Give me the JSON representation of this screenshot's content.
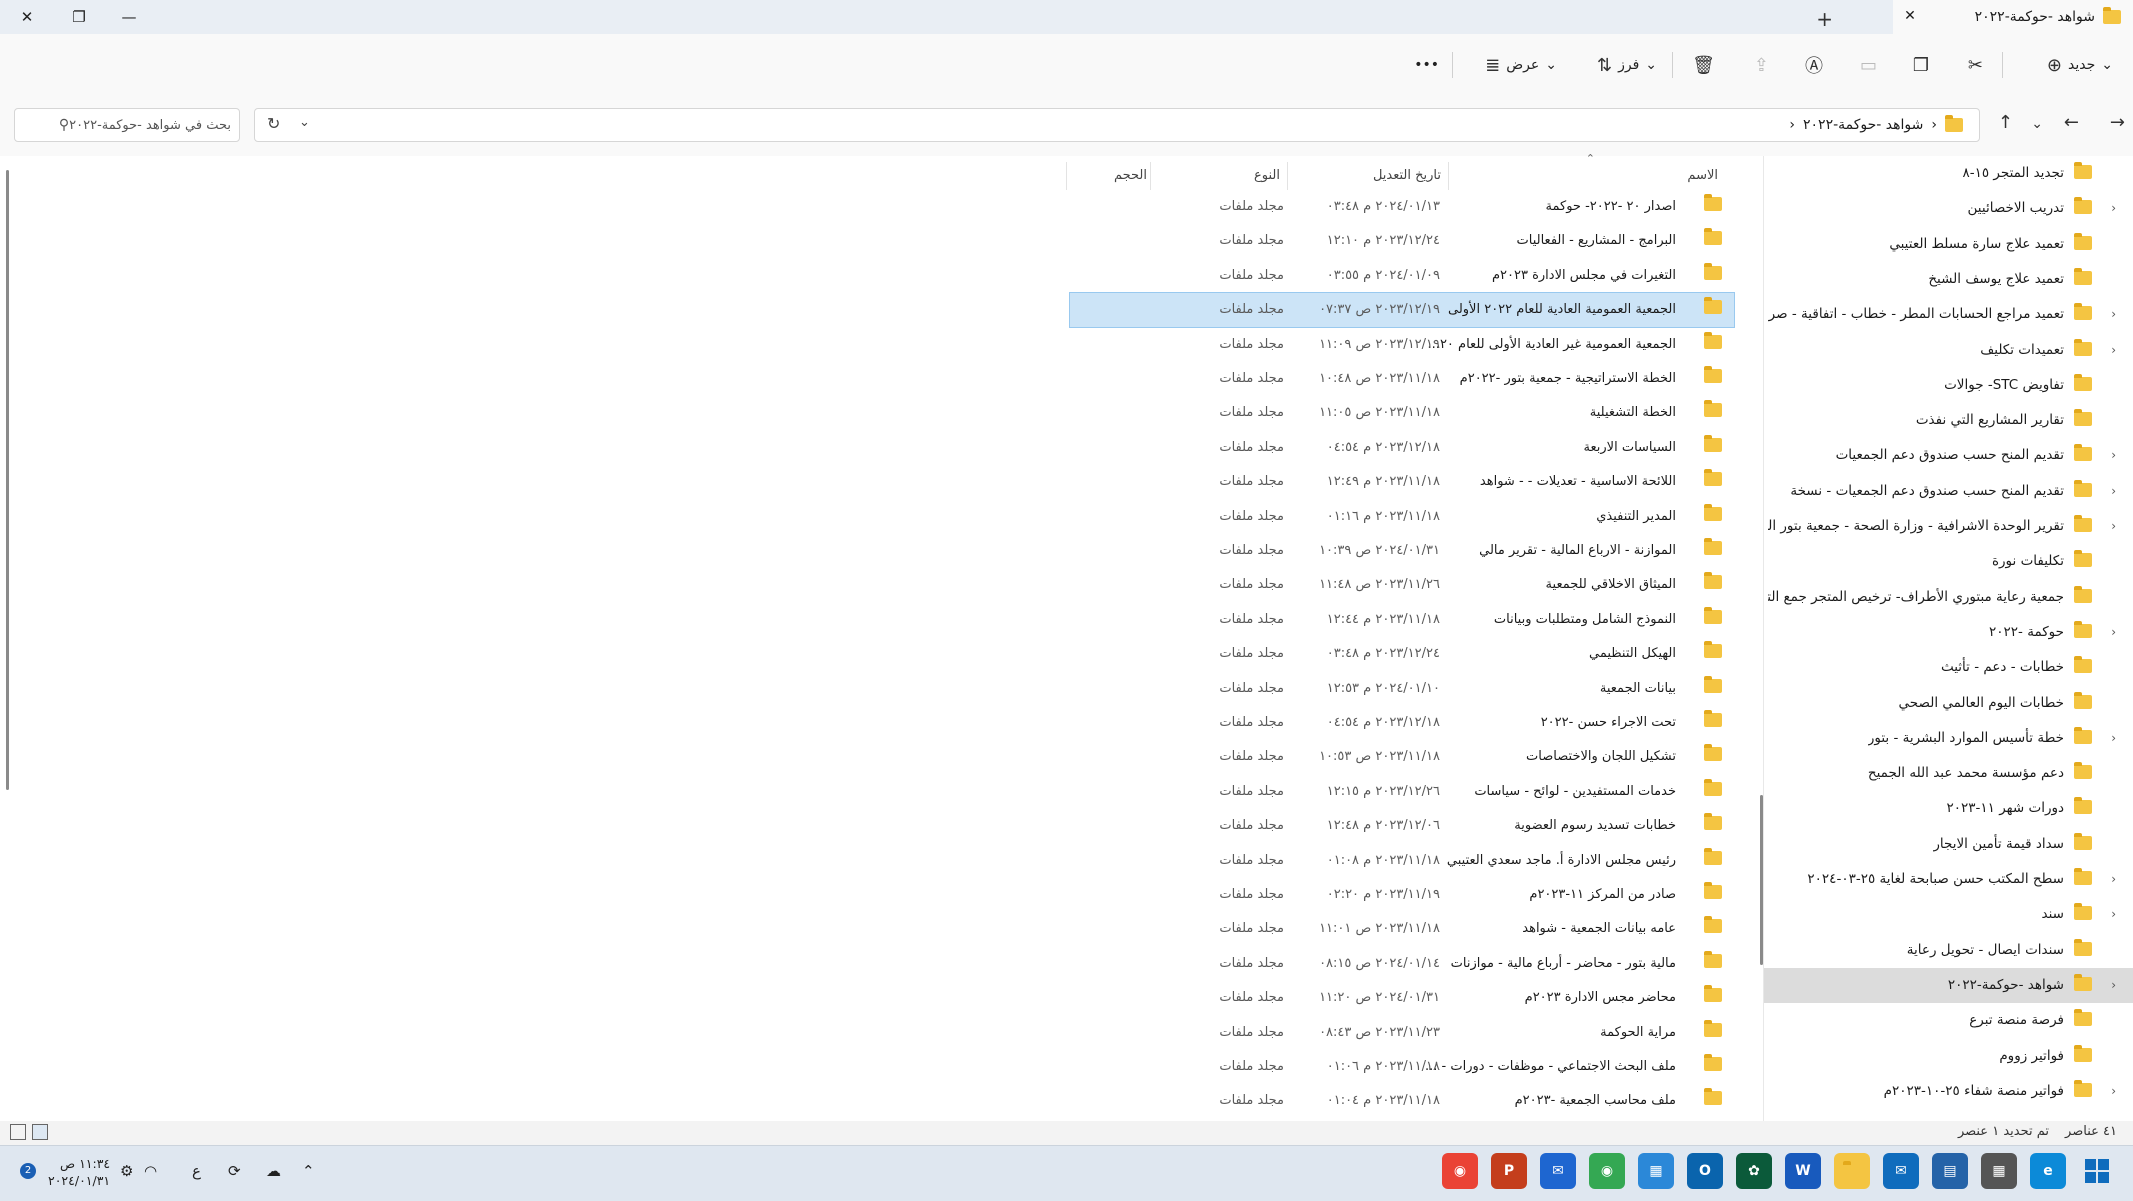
{
  "window": {
    "tab_title": "شواهد -حوكمة-٢٠٢٢",
    "close": "✕",
    "maximize": "❐",
    "minimize": "—",
    "new_tab": "+"
  },
  "toolbar": {
    "new_label": "جديد",
    "sort_label": "فرز",
    "view_label": "عرض",
    "more": "•••",
    "dropdown": "⌄"
  },
  "address": {
    "crumb_sep": "›",
    "current": "شواهد -حوكمة-٢٠٢٢",
    "search_placeholder": "بحث في شواهد -حوكمة-٢٠٢٢"
  },
  "columns": {
    "name": "الاسم",
    "date": "تاريخ التعديل",
    "type": "النوع",
    "size": "الحجم"
  },
  "files": [
    {
      "name": "اصدار ٢٠ -٢٠٢٢- حوكمة",
      "date": "٢٠٢٤/٠١/١٣ م ٠٣:٤٨",
      "type": "مجلد ملفات"
    },
    {
      "name": "البرامج - المشاريع - الفعاليات",
      "date": "٢٠٢٣/١٢/٢٤ م ١٢:١٠",
      "type": "مجلد ملفات"
    },
    {
      "name": "التغيرات في مجلس الادارة ٢٠٢٣م",
      "date": "٢٠٢٤/٠١/٠٩ م ٠٣:٥٥",
      "type": "مجلد ملفات"
    },
    {
      "name": "الجمعية العمومية العادية للعام ٢٠٢٢ الأولى",
      "date": "٢٠٢٣/١٢/١٩ ص ٠٧:٣٧",
      "type": "مجلد ملفات"
    },
    {
      "name": "الجمعية العمومية غير العادية الأولى للعام ٢٠...",
      "date": "٢٠٢٣/١٢/١٩ ص ١١:٠٩",
      "type": "مجلد ملفات"
    },
    {
      "name": "الخطة الاستراتيجية - جمعية بتور -٢٠٢٢م",
      "date": "٢٠٢٣/١١/١٨ ص ١٠:٤٨",
      "type": "مجلد ملفات"
    },
    {
      "name": "الخطة التشغيلية",
      "date": "٢٠٢٣/١١/١٨ ص ١١:٠٥",
      "type": "مجلد ملفات"
    },
    {
      "name": "السياسات الاربعة",
      "date": "٢٠٢٣/١٢/١٨ م ٠٤:٥٤",
      "type": "مجلد ملفات"
    },
    {
      "name": "اللائحة الاساسية - تعديلات - - شواهد",
      "date": "٢٠٢٣/١١/١٨ م ١٢:٤٩",
      "type": "مجلد ملفات"
    },
    {
      "name": "المدير التنفيذي",
      "date": "٢٠٢٣/١١/١٨ م ٠١:١٦",
      "type": "مجلد ملفات"
    },
    {
      "name": "الموازنة - الارباع المالية - تقرير مالي",
      "date": "٢٠٢٤/٠١/٣١ ص ١٠:٣٩",
      "type": "مجلد ملفات"
    },
    {
      "name": "الميثاق الاخلاقي للجمعية",
      "date": "٢٠٢٣/١١/٢٦ ص ١١:٤٨",
      "type": "مجلد ملفات"
    },
    {
      "name": "النموذج الشامل ومتطلبات وبيانات",
      "date": "٢٠٢٣/١١/١٨ م ١٢:٤٤",
      "type": "مجلد ملفات"
    },
    {
      "name": "الهيكل التنظيمي",
      "date": "٢٠٢٣/١٢/٢٤ م ٠٣:٤٨",
      "type": "مجلد ملفات"
    },
    {
      "name": "بيانات الجمعية",
      "date": "٢٠٢٤/٠١/١٠ م ١٢:٥٣",
      "type": "مجلد ملفات"
    },
    {
      "name": "تحت الاجراء حسن -٢٠٢٢",
      "date": "٢٠٢٣/١٢/١٨ م ٠٤:٥٤",
      "type": "مجلد ملفات"
    },
    {
      "name": "تشكيل اللجان والاختصاصات",
      "date": "٢٠٢٣/١١/١٨ ص ١٠:٥٣",
      "type": "مجلد ملفات"
    },
    {
      "name": "خدمات المستفيدين - لوائح - سياسات",
      "date": "٢٠٢٣/١٢/٢٦ م ١٢:١٥",
      "type": "مجلد ملفات"
    },
    {
      "name": "خطابات تسديد رسوم العضوية",
      "date": "٢٠٢٣/١٢/٠٦ م ١٢:٤٨",
      "type": "مجلد ملفات"
    },
    {
      "name": "رئيس مجلس الادارة أ. ماجد سعدي العتيبي",
      "date": "٢٠٢٣/١١/١٨ م ٠١:٠٨",
      "type": "مجلد ملفات"
    },
    {
      "name": "صادر من المركز ١١-٢٠٢٣م",
      "date": "٢٠٢٣/١١/١٩ م ٠٢:٢٠",
      "type": "مجلد ملفات"
    },
    {
      "name": "عامه بيانات الجمعية - شواهد",
      "date": "٢٠٢٣/١١/١٨ ص ١١:٠١",
      "type": "مجلد ملفات"
    },
    {
      "name": "مالية بتور - محاضر - أرباع مالية - موازنات",
      "date": "٢٠٢٤/٠١/١٤ ص ٠٨:١٥",
      "type": "مجلد ملفات"
    },
    {
      "name": "محاضر مجس الادارة ٢٠٢٣م",
      "date": "٢٠٢٤/٠١/٣١ ص ١١:٢٠",
      "type": "مجلد ملفات"
    },
    {
      "name": "مراية الحوكمة",
      "date": "٢٠٢٣/١١/٢٣ ص ٠٨:٤٣",
      "type": "مجلد ملفات"
    },
    {
      "name": "ملف البحث الاجتماعي - موظفات - دورات - ...",
      "date": "٢٠٢٣/١١/١٨ م ٠١:٠٦",
      "type": "مجلد ملفات"
    },
    {
      "name": "ملف محاسب الجمعية -٢٠٢٣م",
      "date": "٢٠٢٣/١١/١٨ م ٠١:٠٤",
      "type": "مجلد ملفات"
    }
  ],
  "nav": [
    {
      "name": "تجديد المتجر ١٥-٨",
      "chev": ""
    },
    {
      "name": "تدريب الاخصائيين",
      "chev": "›"
    },
    {
      "name": "تعميد علاج سارة مسلط العتيبي",
      "chev": ""
    },
    {
      "name": "تعميد علاج يوسف الشيخ",
      "chev": ""
    },
    {
      "name": "تعميد مراجع الحسابات المطر - خطاب - اتفاقية - صرف",
      "chev": "›"
    },
    {
      "name": "تعميدات تكليف",
      "chev": "›"
    },
    {
      "name": "تفاويض STC- جوالات",
      "chev": ""
    },
    {
      "name": "تقارير المشاريع التي نفذت",
      "chev": ""
    },
    {
      "name": "تقديم المنح حسب صندوق دعم الجمعيات",
      "chev": "›"
    },
    {
      "name": "تقديم المنح حسب صندوق دعم الجمعيات - نسخة",
      "chev": "›"
    },
    {
      "name": "تقرير الوحدة الاشرافية - وزارة الصحة - جمعية بتور الص",
      "chev": "›"
    },
    {
      "name": "تكليفات نورة",
      "chev": ""
    },
    {
      "name": "جمعية رعاية مبتوري الأطراف- ترخيص المتجر جمع التبر",
      "chev": ""
    },
    {
      "name": "حوكمة -٢٠٢٢",
      "chev": "›"
    },
    {
      "name": "خطابات - دعم - تأثيث",
      "chev": ""
    },
    {
      "name": "خطابات اليوم العالمي الصحي",
      "chev": ""
    },
    {
      "name": "خطة تأسيس الموارد البشرية - بتور",
      "chev": "›"
    },
    {
      "name": "دعم مؤسسة محمد عبد الله الجميح",
      "chev": ""
    },
    {
      "name": "دورات شهر ١١-٢٠٢٣",
      "chev": ""
    },
    {
      "name": "سداد قيمة تأمين الايجار",
      "chev": ""
    },
    {
      "name": "سطح المكتب حسن صبابحة لغاية ٢٥-٠٣-٢٠٢٤",
      "chev": "›"
    },
    {
      "name": "سند",
      "chev": "›"
    },
    {
      "name": "سندات ايصال - تحويل رعاية",
      "chev": ""
    },
    {
      "name": "شواهد -حوكمة-٢٠٢٢",
      "chev": "›"
    },
    {
      "name": "فرصة منصة تبرع",
      "chev": ""
    },
    {
      "name": "فواتير زووم",
      "chev": ""
    },
    {
      "name": "فواتير منصة شفاء ٢٥-١٠-٢٠٢٣م",
      "chev": "›"
    }
  ],
  "status": {
    "count": "٤١ عناصر",
    "selected": "تم تحديد ١ عنصر"
  },
  "taskbar": {
    "time": "١١:٣٤ ص",
    "date": "٢٠٢٤/٠١/٣١",
    "lang": "ع"
  }
}
